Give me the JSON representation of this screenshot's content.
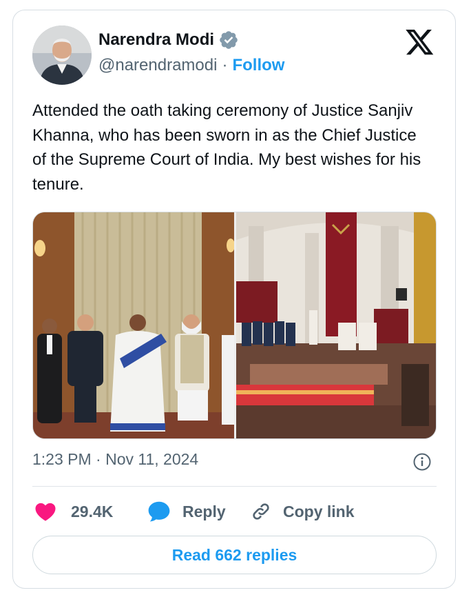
{
  "author": {
    "name": "Narendra Modi",
    "handle": "@narendramodi",
    "separator": "·",
    "follow_label": "Follow",
    "verified_color": "#829aab"
  },
  "tweet": {
    "text": "Attended the oath taking ceremony of Justice Sanjiv Khanna, who has been sworn in as the Chief Justice of the Supreme Court of India. My best wishes for his tenure.",
    "timestamp": "1:23 PM · Nov 11, 2024"
  },
  "actions": {
    "like_count": "29.4K",
    "reply_label": "Reply",
    "copy_link_label": "Copy link",
    "read_replies_label": "Read 662 replies"
  },
  "colors": {
    "accent": "#1d9bf0",
    "like": "#f91880",
    "reply": "#1d9bf0",
    "secondary_text": "#536471"
  },
  "icons": {
    "logo": "x-logo-icon",
    "verified": "verified-badge-icon",
    "info": "info-icon",
    "like": "heart-icon",
    "reply": "speech-bubble-icon",
    "copy": "link-icon"
  }
}
